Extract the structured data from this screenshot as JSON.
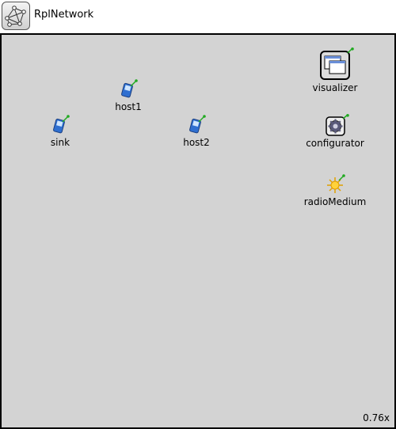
{
  "window": {
    "title": "RplNetwork",
    "icon": "network-icon"
  },
  "nodes": [
    {
      "id": "sink",
      "label": "sink",
      "icon": "wireless-host-icon"
    },
    {
      "id": "host1",
      "label": "host1",
      "icon": "wireless-host-icon"
    },
    {
      "id": "host2",
      "label": "host2",
      "icon": "wireless-host-icon"
    },
    {
      "id": "visualizer",
      "label": "visualizer",
      "icon": "visualizer-icon"
    },
    {
      "id": "configurator",
      "label": "configurator",
      "icon": "configurator-gear-icon"
    },
    {
      "id": "radioMedium",
      "label": "radioMedium",
      "icon": "radio-medium-icon"
    }
  ],
  "zoom": "0.76x",
  "colors": {
    "canvas": "#d3d3d3",
    "border": "#000000",
    "antenna": "#22aa22"
  }
}
